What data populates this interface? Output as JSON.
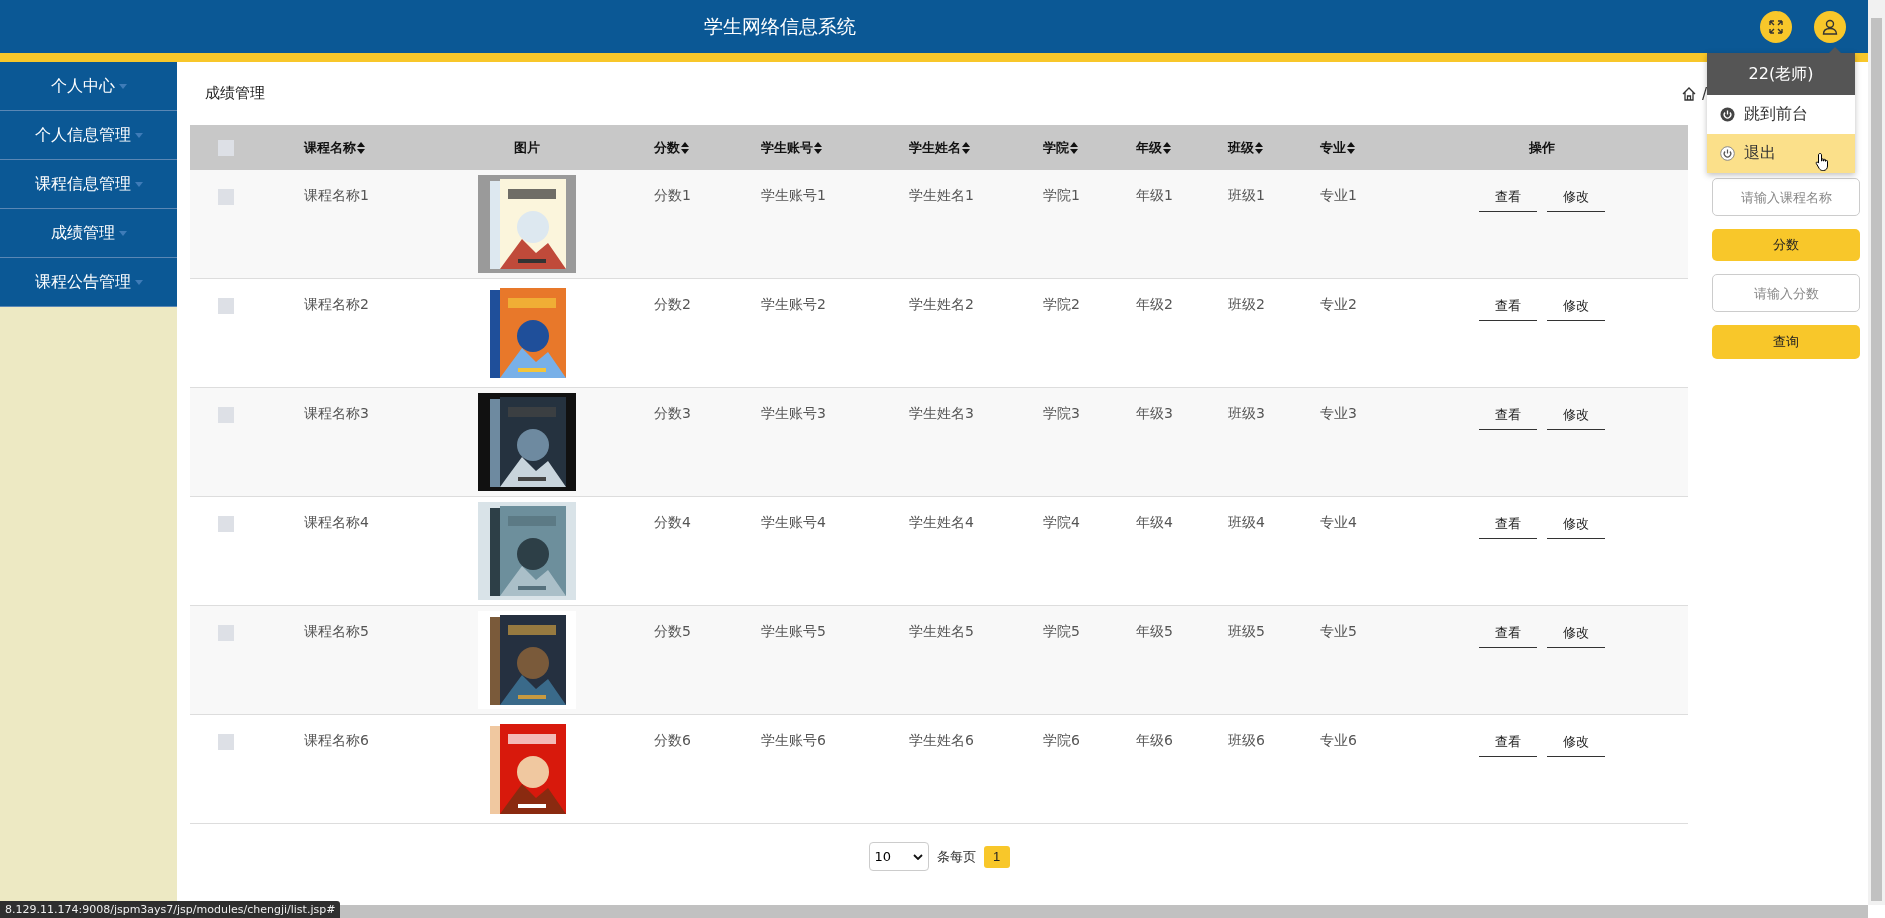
{
  "header": {
    "title": "学生网络信息系统"
  },
  "user_menu": {
    "title": "22(老师)",
    "items": [
      {
        "label": "跳到前台",
        "selected": false
      },
      {
        "label": "退出",
        "selected": true
      }
    ]
  },
  "sidebar": {
    "items": [
      {
        "label": "个人中心"
      },
      {
        "label": "个人信息管理"
      },
      {
        "label": "课程信息管理"
      },
      {
        "label": "成绩管理"
      },
      {
        "label": "课程公告管理"
      }
    ]
  },
  "page_title": "成绩管理",
  "breadcrumb_separator": "/",
  "table": {
    "select_all_checked": false,
    "columns": [
      {
        "label": "课程名称",
        "kind": "text",
        "sortable": true
      },
      {
        "label": "图片",
        "sortable": false
      },
      {
        "label": "分数",
        "kind": "text",
        "sortable": true
      },
      {
        "label": "学生账号",
        "kind": "text",
        "sortable": true
      },
      {
        "label": "学生姓名",
        "kind": "text",
        "sortable": true
      },
      {
        "label": "学院",
        "kind": "text",
        "sortable": true
      },
      {
        "label": "年级",
        "kind": "text",
        "sortable": true
      },
      {
        "label": "班级",
        "kind": "text",
        "sortable": true
      },
      {
        "label": "专业",
        "kind": "text",
        "sortable": true
      },
      {
        "label": "操作",
        "kind": "actions",
        "sortable": false
      }
    ],
    "rows": [
      {
        "checked": false,
        "cells": [
          "课程名称1",
          {
            "kind": "picture"
          },
          "分数1",
          "学生账号1",
          "学生姓名1",
          "学院1",
          "年级1",
          "班级1",
          "专业1",
          [
            "查看",
            "修改"
          ]
        ]
      },
      {
        "checked": false,
        "cells": [
          "课程名称2",
          {
            "kind": "picture"
          },
          "分数2",
          "学生账号2",
          "学生姓名2",
          "学院2",
          "年级2",
          "班级2",
          "专业2",
          [
            "查看",
            "修改"
          ]
        ]
      },
      {
        "checked": false,
        "cells": [
          "课程名称3",
          {
            "kind": "picture"
          },
          "分数3",
          "学生账号3",
          "学生姓名3",
          "学院3",
          "年级3",
          "班级3",
          "专业3",
          [
            "查看",
            "修改"
          ]
        ]
      },
      {
        "checked": false,
        "cells": [
          "课程名称4",
          {
            "kind": "picture"
          },
          "分数4",
          "学生账号4",
          "学生姓名4",
          "学院4",
          "年级4",
          "班级4",
          "专业4",
          [
            "查看",
            "修改"
          ]
        ]
      },
      {
        "checked": false,
        "cells": [
          "课程名称5",
          {
            "kind": "picture"
          },
          "分数5",
          "学生账号5",
          "学生姓名5",
          "学院5",
          "年级5",
          "班级5",
          "专业5",
          [
            "查看",
            "修改"
          ]
        ]
      },
      {
        "checked": false,
        "cells": [
          "课程名称6",
          {
            "kind": "picture"
          },
          "分数6",
          "学生账号6",
          "学生姓名6",
          "学院6",
          "年级6",
          "班级6",
          "专业6",
          [
            "查看",
            "修改"
          ]
        ]
      }
    ]
  },
  "pagination": {
    "page_size": "10",
    "page_size_label": "条每页",
    "pages": [
      {
        "label": "1",
        "selected": true
      }
    ]
  },
  "search_panel": [
    {
      "kind": "input",
      "placeholder": "请输入课程名称"
    },
    {
      "kind": "label",
      "text": "分数"
    },
    {
      "kind": "input",
      "placeholder": "请输入分数"
    },
    {
      "kind": "button",
      "text": "查询"
    }
  ],
  "status_bar": {
    "url": "8.129.11.174:9008/jspm3ays7/jsp/modules/chengji/list.jsp#"
  }
}
